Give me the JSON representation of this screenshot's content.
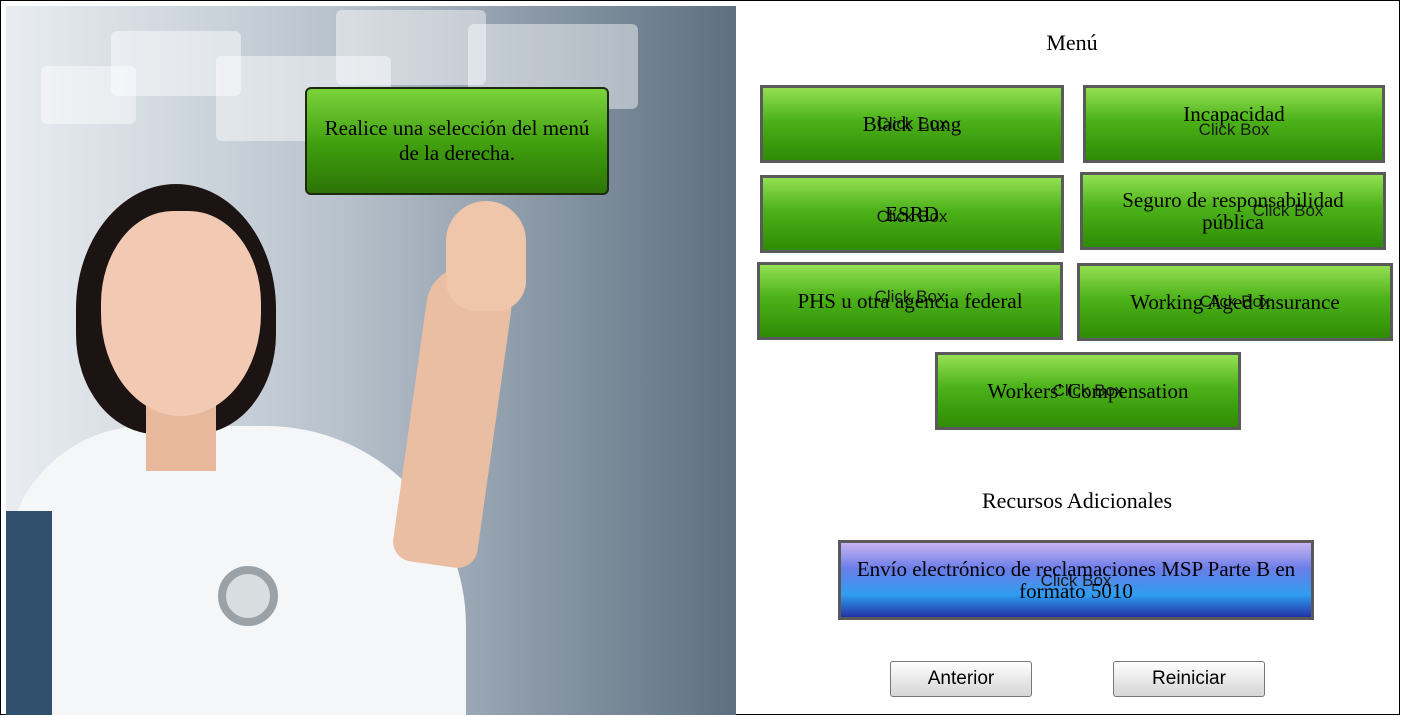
{
  "hero": {
    "prompt": "Realice una selección del menú de la derecha."
  },
  "menu": {
    "title": "Menú",
    "overlay_label": "Click Box",
    "items": [
      {
        "label": "Black Lung"
      },
      {
        "label": "Incapacidad"
      },
      {
        "label": "ESRD"
      },
      {
        "label": "Seguro de responsabilidad pública"
      },
      {
        "label": "PHS u otra agencia federal"
      },
      {
        "label": "Working Aged Insurance"
      },
      {
        "label": "Workers' Compensation"
      }
    ]
  },
  "resources": {
    "title": "Recursos Adicionales",
    "link_label": "Envío electrónico de reclamaciones MSP Parte B en formato 5010"
  },
  "nav": {
    "back_label": "Anterior",
    "reset_label": "Reiniciar"
  }
}
